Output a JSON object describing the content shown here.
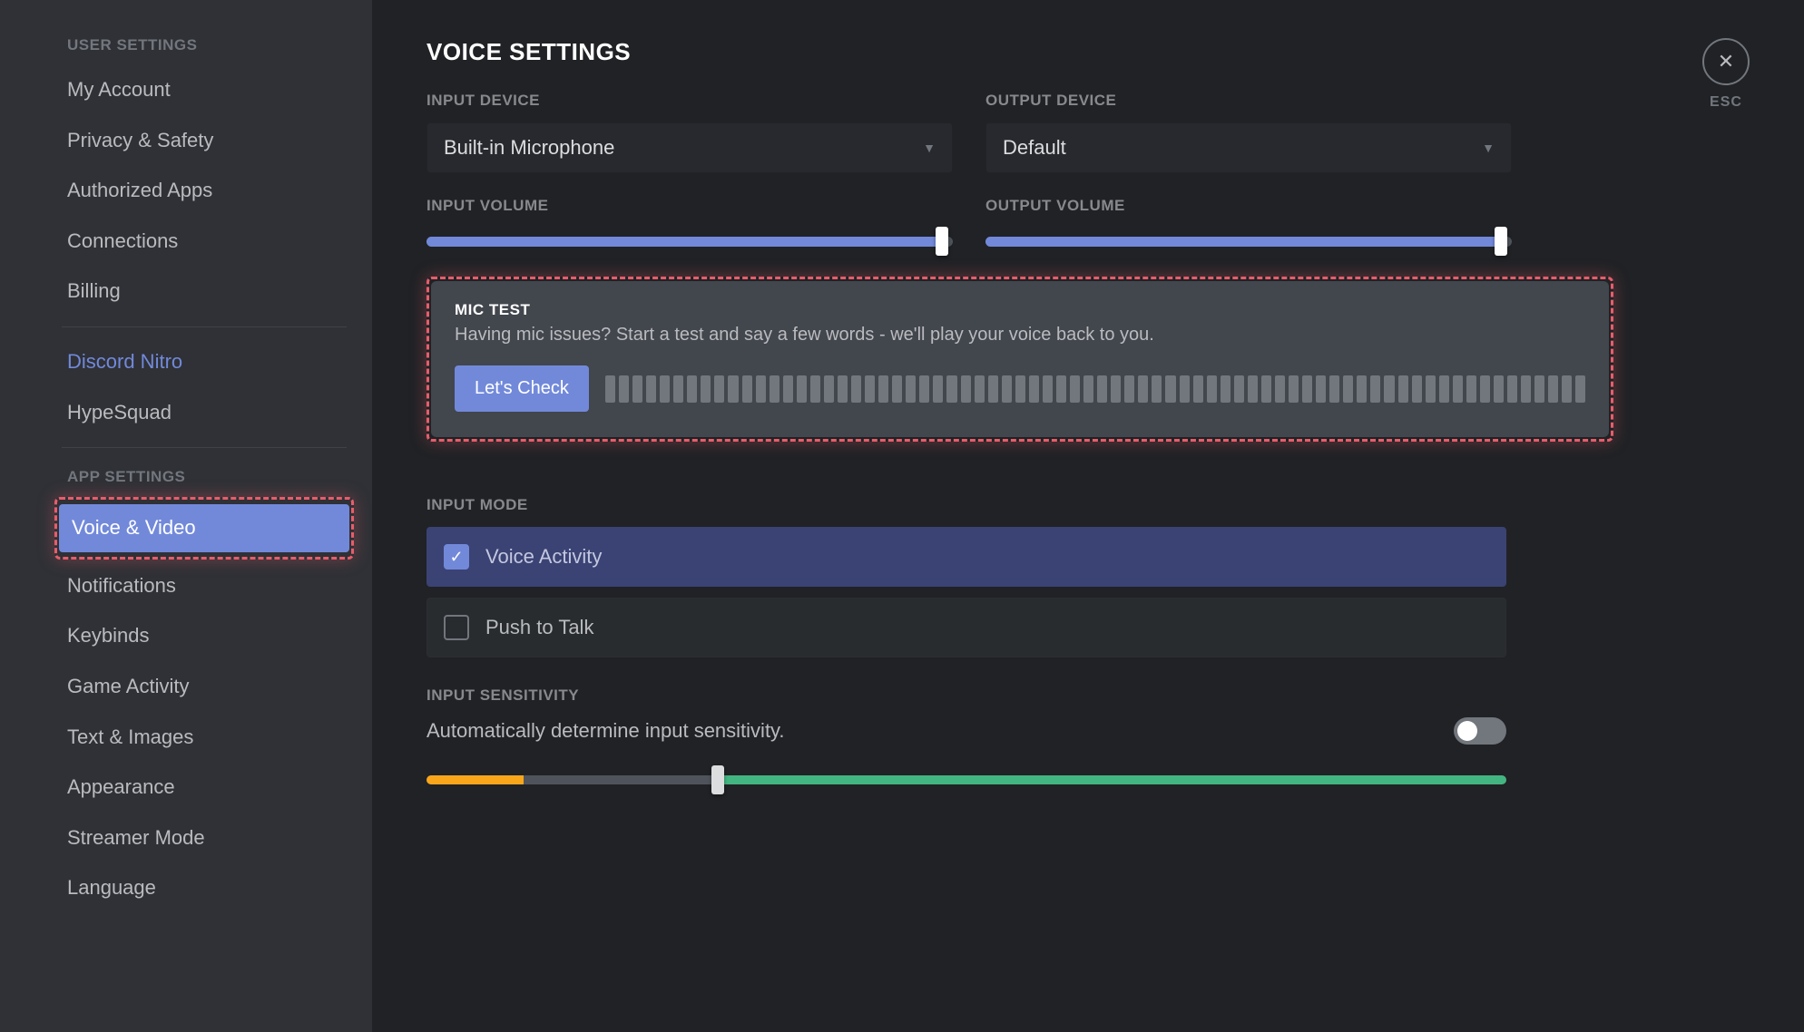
{
  "sidebar": {
    "user_header": "USER SETTINGS",
    "user_items": [
      "My Account",
      "Privacy & Safety",
      "Authorized Apps",
      "Connections",
      "Billing"
    ],
    "nitro": "Discord Nitro",
    "hypesquad": "HypeSquad",
    "app_header": "APP SETTINGS",
    "voice_video": "Voice & Video",
    "app_items": [
      "Notifications",
      "Keybinds",
      "Game Activity",
      "Text & Images",
      "Appearance",
      "Streamer Mode",
      "Language"
    ]
  },
  "page": {
    "title": "VOICE SETTINGS"
  },
  "input": {
    "label": "INPUT DEVICE",
    "value": "Built-in Microphone",
    "vol_label": "INPUT VOLUME",
    "vol_percent": 98
  },
  "output": {
    "label": "OUTPUT DEVICE",
    "value": "Default",
    "vol_label": "OUTPUT VOLUME",
    "vol_percent": 98
  },
  "mictest": {
    "title": "MIC TEST",
    "desc": "Having mic issues? Start a test and say a few words - we'll play your voice back to you.",
    "button": "Let's Check",
    "bar_count": 72
  },
  "mode": {
    "label": "INPUT MODE",
    "options": [
      {
        "label": "Voice Activity",
        "checked": true
      },
      {
        "label": "Push to Talk",
        "checked": false
      }
    ]
  },
  "sensitivity": {
    "label": "INPUT SENSITIVITY",
    "auto_text": "Automatically determine input sensitivity.",
    "auto_on": false,
    "threshold_percent": 27,
    "yellow_percent": 9
  },
  "close": {
    "esc": "ESC"
  }
}
